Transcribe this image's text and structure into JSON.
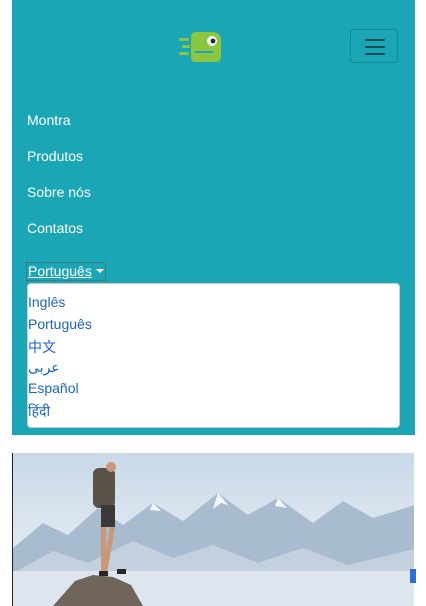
{
  "navbar": {
    "background": "#1aa6b4",
    "logo_icon": "lizard-logo-icon",
    "toggler_icon": "hamburger-menu-icon",
    "links": [
      {
        "label": "Montra"
      },
      {
        "label": "Produtos"
      },
      {
        "label": "Sobre nós"
      },
      {
        "label": "Contatos"
      }
    ],
    "language": {
      "selected": "Português",
      "options": [
        "Inglês",
        "Português",
        "中文",
        "عربى",
        "Español",
        "हिंदी"
      ]
    }
  },
  "hero": {
    "image": "hiker-on-mountain-summit",
    "colors": {
      "sky": "#dfe8f1",
      "mountains": "#9fb3c8",
      "accent": "#2d6fe3"
    }
  }
}
